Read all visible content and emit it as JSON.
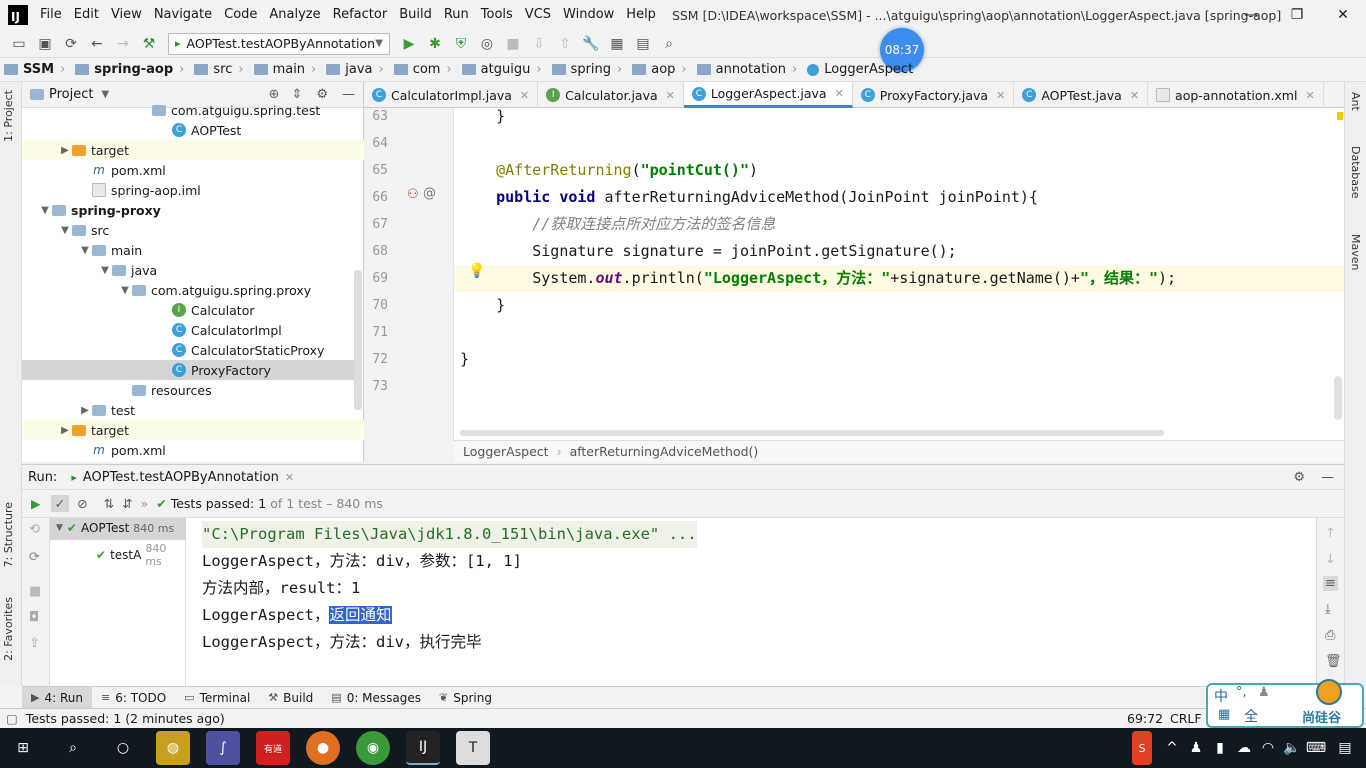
{
  "window": {
    "menus": [
      "File",
      "Edit",
      "View",
      "Navigate",
      "Code",
      "Analyze",
      "Refactor",
      "Build",
      "Run",
      "Tools",
      "VCS",
      "Window",
      "Help"
    ],
    "title": "SSM [D:\\IDEA\\workspace\\SSM] - ...\\atguigu\\spring\\aop\\annotation\\LoggerAspect.java [spring-aop]"
  },
  "toolbar": {
    "run_config": "AOPTest.testAOPByAnnotation",
    "clock": "08:37"
  },
  "navbar": [
    "SSM",
    "spring-aop",
    "src",
    "main",
    "java",
    "com",
    "atguigu",
    "spring",
    "aop",
    "annotation",
    "LoggerAspect"
  ],
  "side_tabs": {
    "left": [
      "1: Project",
      "7: Structure",
      "2: Favorites"
    ],
    "right": [
      "Ant",
      "Database",
      "Maven"
    ]
  },
  "project": {
    "title": "Project",
    "tree": [
      {
        "label": "com.atguigu.spring.test",
        "icon": "folder",
        "indent": 6,
        "arrow": ""
      },
      {
        "label": "AOPTest",
        "icon": "c",
        "indent": 7,
        "arrow": ""
      },
      {
        "label": "target",
        "icon": "folder-orange",
        "indent": 2,
        "arrow": "▶",
        "highlight": true
      },
      {
        "label": "pom.xml",
        "icon": "file",
        "indent": 3,
        "arrow": "",
        "prefix": "m"
      },
      {
        "label": "spring-aop.iml",
        "icon": "file",
        "indent": 3,
        "arrow": ""
      },
      {
        "label": "spring-proxy",
        "icon": "folder",
        "indent": 1,
        "arrow": "▼",
        "bold": true
      },
      {
        "label": "src",
        "icon": "folder",
        "indent": 2,
        "arrow": "▼"
      },
      {
        "label": "main",
        "icon": "folder",
        "indent": 3,
        "arrow": "▼"
      },
      {
        "label": "java",
        "icon": "folder",
        "indent": 4,
        "arrow": "▼"
      },
      {
        "label": "com.atguigu.spring.proxy",
        "icon": "folder",
        "indent": 5,
        "arrow": "▼"
      },
      {
        "label": "Calculator",
        "icon": "i",
        "indent": 7,
        "arrow": ""
      },
      {
        "label": "CalculatorImpl",
        "icon": "c",
        "indent": 7,
        "arrow": ""
      },
      {
        "label": "CalculatorStaticProxy",
        "icon": "c",
        "indent": 7,
        "arrow": ""
      },
      {
        "label": "ProxyFactory",
        "icon": "c",
        "indent": 7,
        "arrow": "",
        "selected": true
      },
      {
        "label": "resources",
        "icon": "folder",
        "indent": 5,
        "arrow": ""
      },
      {
        "label": "test",
        "icon": "folder",
        "indent": 3,
        "arrow": "▶"
      },
      {
        "label": "target",
        "icon": "folder-orange",
        "indent": 2,
        "arrow": "▶",
        "highlight": true
      },
      {
        "label": "pom.xml",
        "icon": "file",
        "indent": 3,
        "arrow": "",
        "prefix": "m"
      }
    ]
  },
  "editor_tabs": [
    {
      "label": "CalculatorImpl.java",
      "icon": "c"
    },
    {
      "label": "Calculator.java",
      "icon": "i"
    },
    {
      "label": "LoggerAspect.java",
      "icon": "c",
      "active": true
    },
    {
      "label": "ProxyFactory.java",
      "icon": "c"
    },
    {
      "label": "AOPTest.java",
      "icon": "c"
    },
    {
      "label": "aop-annotation.xml",
      "icon": "file"
    }
  ],
  "editor": {
    "line_numbers": [
      "63",
      "64",
      "65",
      "66",
      "67",
      "68",
      "69",
      "70",
      "71",
      "72",
      "73"
    ],
    "lines": [
      {
        "segments": [
          {
            "t": "    }",
            "c": ""
          }
        ]
      },
      {
        "segments": [
          {
            "t": "",
            "c": ""
          }
        ]
      },
      {
        "segments": [
          {
            "t": "    ",
            "c": ""
          },
          {
            "t": "@AfterReturning",
            "c": "ann"
          },
          {
            "t": "(",
            "c": ""
          },
          {
            "t": "\"pointCut()\"",
            "c": "str"
          },
          {
            "t": ")",
            "c": ""
          }
        ]
      },
      {
        "segments": [
          {
            "t": "    ",
            "c": ""
          },
          {
            "t": "public void ",
            "c": "kw"
          },
          {
            "t": "afterReturningAdviceMethod(JoinPoint joinPoint){",
            "c": ""
          }
        ]
      },
      {
        "segments": [
          {
            "t": "        ",
            "c": ""
          },
          {
            "t": "//获取连接点所对应方法的签名信息",
            "c": "cmt"
          }
        ]
      },
      {
        "segments": [
          {
            "t": "        Signature signature = joinPoint.getSignature();",
            "c": ""
          }
        ]
      },
      {
        "segments": [
          {
            "t": "        System.",
            "c": ""
          },
          {
            "t": "out",
            "c": "fld"
          },
          {
            "t": ".println(",
            "c": ""
          },
          {
            "t": "\"LoggerAspect，方法：\"",
            "c": "str"
          },
          {
            "t": "+signature.getName()+",
            "c": ""
          },
          {
            "t": "\"，结果：\"",
            "c": "str"
          },
          {
            "t": ");",
            "c": ""
          }
        ]
      },
      {
        "segments": [
          {
            "t": "    }",
            "c": ""
          }
        ]
      },
      {
        "segments": [
          {
            "t": "",
            "c": ""
          }
        ]
      },
      {
        "segments": [
          {
            "t": "}",
            "c": ""
          }
        ]
      },
      {
        "segments": [
          {
            "t": "",
            "c": ""
          }
        ]
      }
    ],
    "breadcrumb": [
      "LoggerAspect",
      "afterReturningAdviceMethod()"
    ]
  },
  "run_panel": {
    "label": "Run:",
    "tab": "AOPTest.testAOPByAnnotation",
    "tests_passed": "Tests passed:",
    "passed_count": "1",
    "of_total": "of 1 test",
    "duration": "– 840 ms",
    "tree": [
      {
        "label": "AOPTest",
        "time": "840 ms"
      },
      {
        "label": "testA",
        "time": "840 ms"
      }
    ],
    "console": [
      "\"C:\\Program Files\\Java\\jdk1.8.0_151\\bin\\java.exe\" ...",
      "LoggerAspect，方法：div，参数：[1, 1]",
      "方法内部，result：1",
      "LoggerAspect，",
      "LoggerAspect，方法：div，执行完毕"
    ],
    "selected_text": "返回通知"
  },
  "bottom_tabs": [
    "4: Run",
    "6: TODO",
    "Terminal",
    "Build",
    "0: Messages",
    "Spring"
  ],
  "status": {
    "message": "Tests passed: 1 (2 minutes ago)",
    "position": "69:72",
    "line_sep": "CRLF"
  },
  "ime": {
    "mode": "中",
    "brand": "尚硅谷",
    "full": "全"
  },
  "colors": {
    "accent": "#4083c9",
    "selection": "#2f65ca",
    "string": "#008000",
    "keyword": "#000080",
    "annotation": "#808000"
  }
}
